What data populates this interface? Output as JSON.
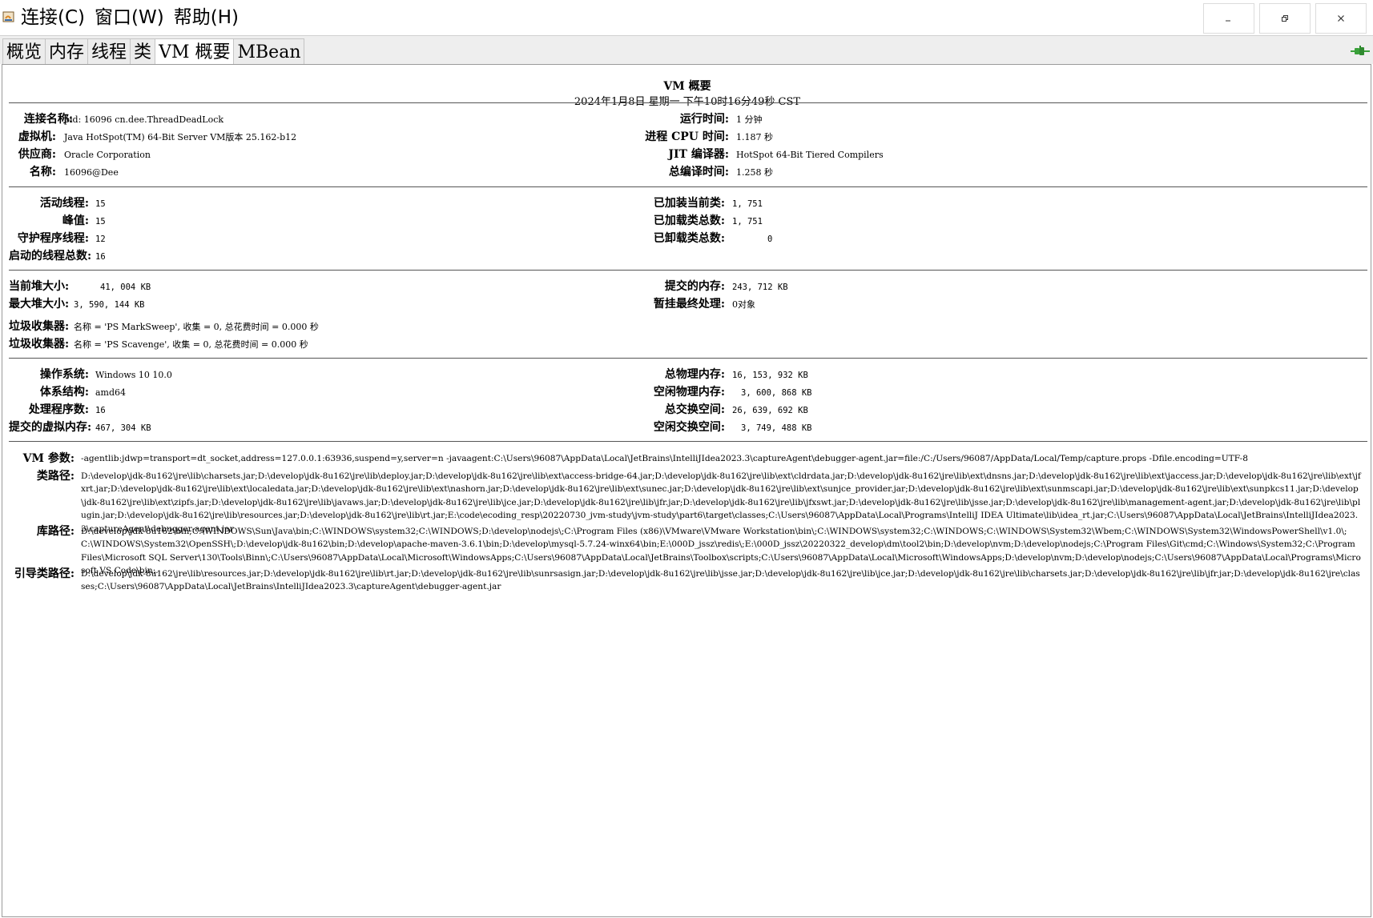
{
  "menu": {
    "items": [
      "连接(C)",
      "窗口(W)",
      "帮助(H)"
    ]
  },
  "window_controls": {
    "minimize": "minimize-icon",
    "restore": "restore-icon",
    "close": "close-icon"
  },
  "tabs": [
    "概览",
    "内存",
    "线程",
    "类",
    "VM 概要",
    "MBean"
  ],
  "active_tab": "VM 概要",
  "colors": {
    "connected_icon": "#3aa13a",
    "app_icon": "#d9892a"
  },
  "summary": {
    "title": "VM 概要",
    "datetime": "2024年1月8日 星期一 下午10时16分49秒 CST"
  },
  "vm_info": {
    "connection_name_label": "连接名称:",
    "connection_name": "pid: 16096 cn.dee.ThreadDeadLock",
    "vm_label": "虚拟机:",
    "vm": "Java HotSpot(TM) 64-Bit Server VM版本 25.162-b12",
    "vendor_label": "供应商:",
    "vendor": "Oracle Corporation",
    "name_label": "名称:",
    "name": "16096@Dee",
    "uptime_label": "运行时间:",
    "uptime": "1 分钟",
    "cpu_time_label": "进程 CPU 时间:",
    "cpu_time": "1.187 秒",
    "jit_label": "JIT 编译器:",
    "jit": "HotSpot 64-Bit Tiered Compilers",
    "compile_time_label": "总编译时间:",
    "compile_time": "1.258 秒"
  },
  "threads": {
    "live_label": "活动线程:",
    "live": "15",
    "peak_label": "峰值:",
    "peak": "15",
    "daemon_label": "守护程序线程:",
    "daemon": "12",
    "started_label": "启动的线程总数:",
    "started": "16",
    "loaded_label": "已加装当前类:",
    "loaded": "1, 751",
    "total_loaded_label": "已加载类总数:",
    "total_loaded": "1, 751",
    "unloaded_label": "已卸载类总数:",
    "unloaded": "0"
  },
  "memory": {
    "heap_label": "当前堆大小:",
    "heap": "41, 004 KB",
    "max_heap_label": "最大堆大小:",
    "max_heap": "3, 590, 144 KB",
    "committed_label": "提交的内存:",
    "committed": "243, 712 KB",
    "finalization_label": "暂挂最终处理:",
    "finalization": "0对象",
    "gc1_label": "垃圾收集器:",
    "gc1": "名称 = 'PS MarkSweep', 收集 = 0, 总花费时间 = 0.000 秒",
    "gc2_label": "垃圾收集器:",
    "gc2": "名称 = 'PS Scavenge', 收集 = 0, 总花费时间 = 0.000 秒"
  },
  "os": {
    "os_label": "操作系统:",
    "os": "Windows 10 10.0",
    "arch_label": "体系结构:",
    "arch": "amd64",
    "cpus_label": "处理程序数:",
    "cpus": "16",
    "vmem_label": "提交的虚拟内存:",
    "vmem": "467, 304 KB",
    "phys_label": "总物理内存:",
    "phys": "16, 153, 932 KB",
    "free_phys_label": "空闲物理内存:",
    "free_phys": "3, 600, 868 KB",
    "swap_label": "总交换空间:",
    "swap": "26, 639, 692 KB",
    "free_swap_label": "空闲交换空间:",
    "free_swap": "3, 749, 488 KB"
  },
  "paths": {
    "vm_args_label": "VM 参数:",
    "vm_args": "-agentlib:jdwp=transport=dt_socket,address=127.0.0.1:63936,suspend=y,server=n -javaagent:C:\\Users\\96087\\AppData\\Local\\JetBrains\\IntelliJIdea2023.3\\captureAgent\\debugger-agent.jar=file:/C:/Users/96087/AppData/Local/Temp/capture.props -Dfile.encoding=UTF-8",
    "classpath_label": "类路径:",
    "classpath": "D:\\develop\\jdk-8u162\\jre\\lib\\charsets.jar;D:\\develop\\jdk-8u162\\jre\\lib\\deploy.jar;D:\\develop\\jdk-8u162\\jre\\lib\\ext\\access-bridge-64.jar;D:\\develop\\jdk-8u162\\jre\\lib\\ext\\cldrdata.jar;D:\\develop\\jdk-8u162\\jre\\lib\\ext\\dnsns.jar;D:\\develop\\jdk-8u162\\jre\\lib\\ext\\jaccess.jar;D:\\develop\\jdk-8u162\\jre\\lib\\ext\\jfxrt.jar;D:\\develop\\jdk-8u162\\jre\\lib\\ext\\localedata.jar;D:\\develop\\jdk-8u162\\jre\\lib\\ext\\nashorn.jar;D:\\develop\\jdk-8u162\\jre\\lib\\ext\\sunec.jar;D:\\develop\\jdk-8u162\\jre\\lib\\ext\\sunjce_provider.jar;D:\\develop\\jdk-8u162\\jre\\lib\\ext\\sunmscapi.jar;D:\\develop\\jdk-8u162\\jre\\lib\\ext\\sunpkcs11.jar;D:\\develop\\jdk-8u162\\jre\\lib\\ext\\zipfs.jar;D:\\develop\\jdk-8u162\\jre\\lib\\javaws.jar;D:\\develop\\jdk-8u162\\jre\\lib\\jce.jar;D:\\develop\\jdk-8u162\\jre\\lib\\jfr.jar;D:\\develop\\jdk-8u162\\jre\\lib\\jfxswt.jar;D:\\develop\\jdk-8u162\\jre\\lib\\jsse.jar;D:\\develop\\jdk-8u162\\jre\\lib\\management-agent.jar;D:\\develop\\jdk-8u162\\jre\\lib\\plugin.jar;D:\\develop\\jdk-8u162\\jre\\lib\\resources.jar;D:\\develop\\jdk-8u162\\jre\\lib\\rt.jar;E:\\code\\ecoding_resp\\20220730_jvm-study\\jvm-study\\part6\\target\\classes;C:\\Users\\96087\\AppData\\Local\\Programs\\IntelliJ IDEA Ultimate\\lib\\idea_rt.jar;C:\\Users\\96087\\AppData\\Local\\JetBrains\\IntelliJIdea2023.3\\captureAgent\\debugger-agent.jar",
    "libpath_label": "库路径:",
    "libpath": "D:\\develop\\jdk-8u162\\bin;C:\\WINDOWS\\Sun\\Java\\bin;C:\\WINDOWS\\system32;C:\\WINDOWS;D:\\develop\\nodejs\\;C:\\Program Files (x86)\\VMware\\VMware Workstation\\bin\\;C:\\WINDOWS\\system32;C:\\WINDOWS;C:\\WINDOWS\\System32\\Wbem;C:\\WINDOWS\\System32\\WindowsPowerShell\\v1.0\\;C:\\WINDOWS\\System32\\OpenSSH\\;D:\\develop\\jdk-8u162\\bin;D:\\develop\\apache-maven-3.6.1\\bin;D:\\develop\\mysql-5.7.24-winx64\\bin;E:\\000D_jssz\\redis\\;E:\\000D_jssz\\20220322_develop\\dm\\tool2\\bin;D:\\develop\\nvm;D:\\develop\\nodejs;C:\\Program Files\\Git\\cmd;C:\\Windows\\System32;C:\\Program Files\\Microsoft SQL Server\\130\\Tools\\Binn\\;C:\\Users\\96087\\AppData\\Local\\Microsoft\\WindowsApps;C:\\Users\\96087\\AppData\\Local\\JetBrains\\Toolbox\\scripts;C:\\Users\\96087\\AppData\\Local\\Microsoft\\WindowsApps;D:\\develop\\nvm;D:\\develop\\nodejs;C:\\Users\\96087\\AppData\\Local\\Programs\\Microsoft VS Code\\bin;.",
    "bootpath_label": "引导类路径:",
    "bootpath": "D:\\develop\\jdk-8u162\\jre\\lib\\resources.jar;D:\\develop\\jdk-8u162\\jre\\lib\\rt.jar;D:\\develop\\jdk-8u162\\jre\\lib\\sunrsasign.jar;D:\\develop\\jdk-8u162\\jre\\lib\\jsse.jar;D:\\develop\\jdk-8u162\\jre\\lib\\jce.jar;D:\\develop\\jdk-8u162\\jre\\lib\\charsets.jar;D:\\develop\\jdk-8u162\\jre\\lib\\jfr.jar;D:\\develop\\jdk-8u162\\jre\\classes;C:\\Users\\96087\\AppData\\Local\\JetBrains\\IntelliJIdea2023.3\\captureAgent\\debugger-agent.jar"
  }
}
